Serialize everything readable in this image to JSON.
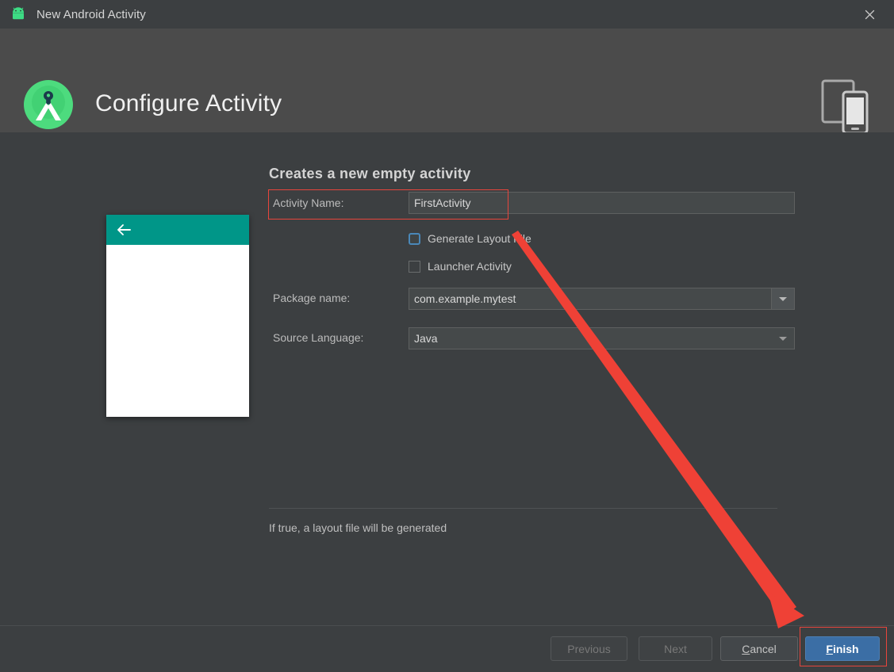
{
  "window": {
    "title": "New Android Activity",
    "app_icon": "android-robot-icon",
    "close_icon": "close-icon"
  },
  "header": {
    "title": "Configure Activity",
    "logo_icon": "android-studio-logo-icon",
    "form_factor_icon": "phone-tablet-icon"
  },
  "preview": {
    "name": "activity-preview-thumbnail",
    "appbar_color": "#009688",
    "back_icon": "arrow-left-icon"
  },
  "form": {
    "heading": "Creates a new empty activity",
    "activity_name": {
      "label": "Activity Name:",
      "value": "FirstActivity"
    },
    "generate_layout": {
      "label": "Generate Layout File",
      "checked": false,
      "focused": true
    },
    "launcher_activity": {
      "label": "Launcher Activity",
      "checked": false,
      "focused": false
    },
    "package_name": {
      "label": "Package name:",
      "value": "com.example.mytest"
    },
    "source_language": {
      "label": "Source Language:",
      "value": "Java"
    },
    "hint": "If true, a layout file will be generated"
  },
  "footer": {
    "previous": "Previous",
    "next": "Next",
    "cancel_pre": "",
    "cancel_mnemonic": "C",
    "cancel_post": "ancel",
    "finish_mnemonic": "F",
    "finish_post": "inish"
  },
  "annotations": {
    "highlight_color": "#e8453c",
    "boxes": [
      "activity-name-row",
      "finish-button"
    ],
    "arrow": "red-arrow-pointing-to-finish-button"
  }
}
